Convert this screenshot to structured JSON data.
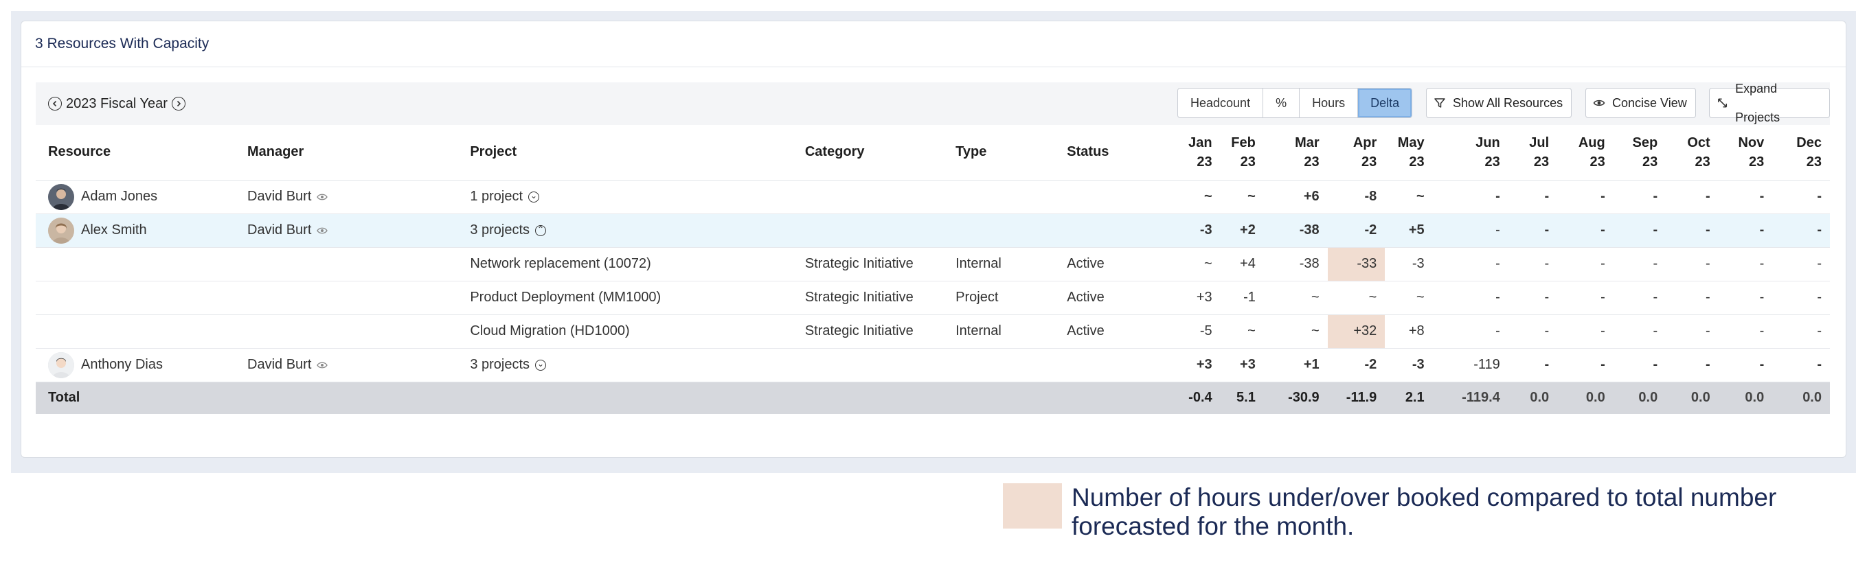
{
  "card": {
    "title": "3 Resources With Capacity"
  },
  "toolbar": {
    "fiscal_year": "2023 Fiscal Year",
    "modes": [
      "Headcount",
      "%",
      "Hours",
      "Delta"
    ],
    "active_mode": "Delta",
    "show_all": "Show All Resources",
    "concise": "Concise View",
    "expand": "Expand Projects"
  },
  "columns": {
    "resource": "Resource",
    "manager": "Manager",
    "project": "Project",
    "category": "Category",
    "type": "Type",
    "status": "Status",
    "months": [
      [
        "Jan",
        "23"
      ],
      [
        "Feb",
        "23"
      ],
      [
        "Mar",
        "23"
      ],
      [
        "Apr",
        "23"
      ],
      [
        "May",
        "23"
      ],
      [
        "Jun",
        "23"
      ],
      [
        "Jul",
        "23"
      ],
      [
        "Aug",
        "23"
      ],
      [
        "Sep",
        "23"
      ],
      [
        "Oct",
        "23"
      ],
      [
        "Nov",
        "23"
      ],
      [
        "Dec",
        "23"
      ]
    ]
  },
  "rows": [
    {
      "kind": "resource",
      "resource": "Adam Jones",
      "manager": "David Burt",
      "project": "1 project",
      "category": "",
      "type": "",
      "status": "",
      "values": [
        "~",
        "~",
        "+6",
        "-8",
        "~",
        "-",
        "-",
        "-",
        "-",
        "-",
        "-",
        "-"
      ]
    },
    {
      "kind": "resource",
      "highlight": true,
      "resource": "Alex Smith",
      "manager": "David Burt",
      "project": "3 projects",
      "category": "",
      "type": "",
      "status": "",
      "values": [
        "-3",
        "+2",
        "-38",
        "-2",
        "+5",
        "-",
        "-",
        "-",
        "-",
        "-",
        "-",
        "-"
      ]
    },
    {
      "kind": "sub",
      "resource": "",
      "manager": "",
      "project": "Network replacement (10072)",
      "category": "Strategic Initiative",
      "type": "Internal",
      "status": "Active",
      "values": [
        "~",
        "+4",
        "-38",
        "-33",
        "-3",
        "-",
        "-",
        "-",
        "-",
        "-",
        "-",
        "-"
      ]
    },
    {
      "kind": "sub",
      "resource": "",
      "manager": "",
      "project": "Product Deployment (MM1000)",
      "category": "Strategic Initiative",
      "type": "Project",
      "status": "Active",
      "values": [
        "+3",
        "-1",
        "~",
        "~",
        "~",
        "-",
        "-",
        "-",
        "-",
        "-",
        "-",
        "-"
      ]
    },
    {
      "kind": "sub",
      "resource": "",
      "manager": "",
      "project": "Cloud Migration (HD1000)",
      "category": "Strategic Initiative",
      "type": "Internal",
      "status": "Active",
      "values": [
        "-5",
        "~",
        "~",
        "+32",
        "+8",
        "-",
        "-",
        "-",
        "-",
        "-",
        "-",
        "-"
      ]
    },
    {
      "kind": "resource",
      "resource": "Anthony Dias",
      "manager": "David Burt",
      "project": "3 projects",
      "category": "",
      "type": "",
      "status": "",
      "values": [
        "+3",
        "+3",
        "+1",
        "-2",
        "-3",
        "-119",
        "-",
        "-",
        "-",
        "-",
        "-",
        "-"
      ]
    }
  ],
  "total": {
    "label": "Total",
    "values": [
      "-0.4",
      "5.1",
      "-30.9",
      "-11.9",
      "2.1",
      "-119.4",
      "0.0",
      "0.0",
      "0.0",
      "0.0",
      "0.0",
      "0.0"
    ]
  },
  "legend": {
    "text": "Number of hours under/over booked compared to total number forecasted for the month.",
    "color": "#f1ddd1"
  },
  "colors": {
    "positive": "#c43a2d",
    "negative": "#2f8a5b",
    "highlight_row": "#eaf6fc",
    "active_mode": "#9ec5ee"
  }
}
